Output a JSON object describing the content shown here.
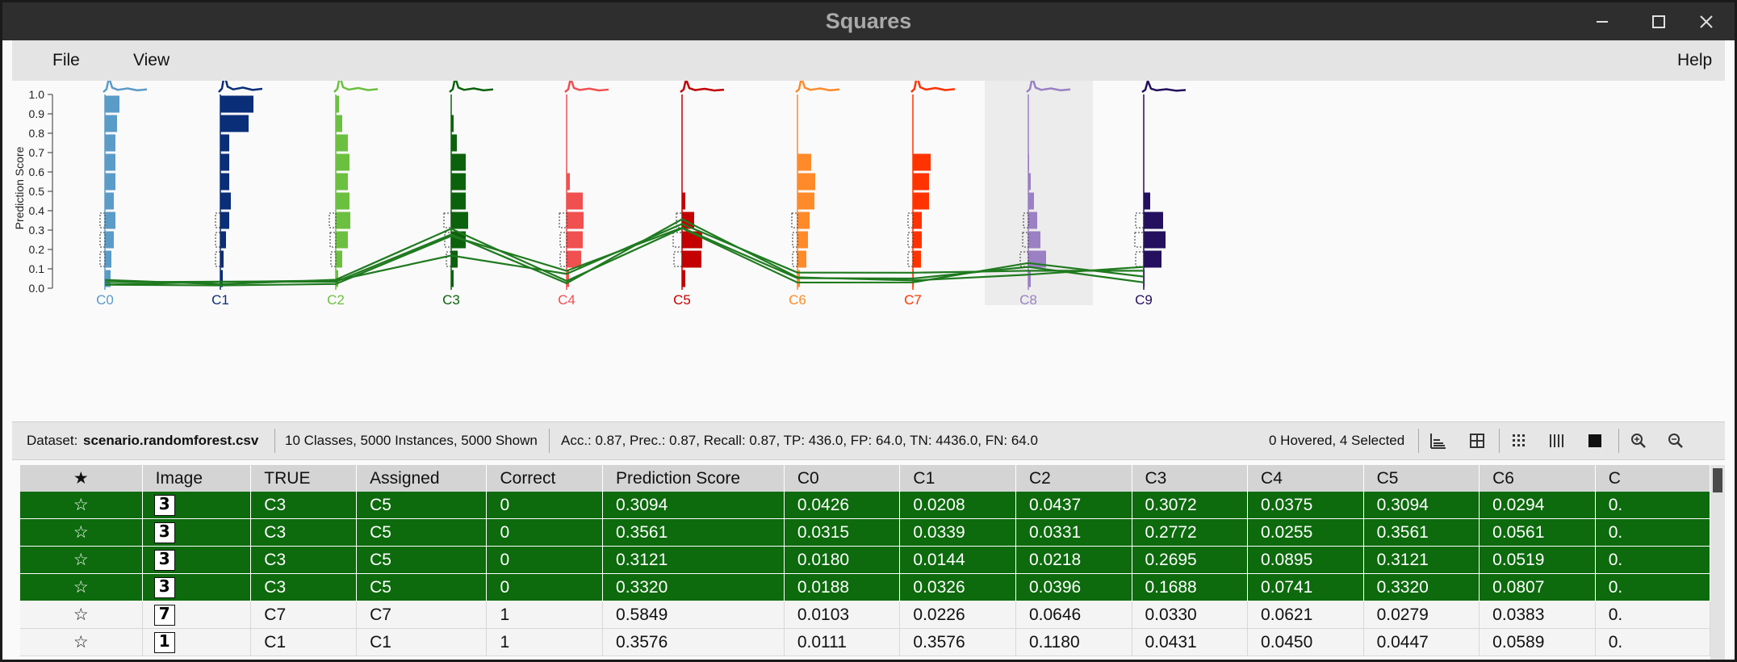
{
  "window": {
    "title": "Squares"
  },
  "menu": {
    "file": "File",
    "view": "View",
    "help": "Help"
  },
  "chart_data": {
    "type": "bar",
    "ylabel": "Prediction Score",
    "ylim": [
      0,
      1
    ],
    "yticks": [
      "0.0",
      "0.1",
      "0.2",
      "0.3",
      "0.4",
      "0.5",
      "0.6",
      "0.7",
      "0.8",
      "0.9",
      "1.0"
    ],
    "classes": [
      "C0",
      "C1",
      "C2",
      "C3",
      "C4",
      "C5",
      "C6",
      "C7",
      "C8",
      "C9"
    ],
    "colors": [
      "#5b9bc8",
      "#0a2e78",
      "#6cc040",
      "#0c620c",
      "#f05050",
      "#c40000",
      "#ff8a2a",
      "#ff3300",
      "#9b80c4",
      "#24105e"
    ],
    "hovered_class": "C8",
    "histograms": [
      [
        0.25,
        0.3,
        0.4,
        0.45,
        0.4,
        0.45,
        0.45,
        0.45,
        0.55,
        0.65
      ],
      [
        0.1,
        0.15,
        0.25,
        0.4,
        0.45,
        0.4,
        0.4,
        0.4,
        1.25,
        1.45
      ],
      [
        0.1,
        0.3,
        0.55,
        0.65,
        0.6,
        0.55,
        0.6,
        0.55,
        0.3,
        0.15
      ],
      [
        0.1,
        0.3,
        0.65,
        0.75,
        0.65,
        0.65,
        0.65,
        0.25,
        0.1,
        0.0
      ],
      [
        0.1,
        0.65,
        0.7,
        0.75,
        0.7,
        0.15,
        0.0,
        0.0,
        0.0,
        0.0
      ],
      [
        0.15,
        0.85,
        0.9,
        0.55,
        0.15,
        0.0,
        0.0,
        0.0,
        0.0,
        0.0
      ],
      [
        0.1,
        0.4,
        0.45,
        0.55,
        0.75,
        0.8,
        0.6,
        0.0,
        0.0,
        0.0
      ],
      [
        0.05,
        0.35,
        0.4,
        0.4,
        0.7,
        0.7,
        0.8,
        0.0,
        0.0,
        0.0
      ],
      [
        0.1,
        0.8,
        0.55,
        0.4,
        0.25,
        0.12,
        0.05,
        0.0,
        0.0,
        0.0
      ],
      [
        0.05,
        0.8,
        0.95,
        0.85,
        0.3,
        0.0,
        0.0,
        0.0,
        0.0,
        0.0
      ]
    ],
    "selected_lines": [
      [
        0.0426,
        0.0208,
        0.0437,
        0.3072,
        0.0375,
        0.3094,
        0.0294,
        0.03,
        0.13,
        0.06
      ],
      [
        0.0315,
        0.0339,
        0.0331,
        0.2772,
        0.0255,
        0.3561,
        0.0561,
        0.04,
        0.07,
        0.11
      ],
      [
        0.018,
        0.0144,
        0.0218,
        0.2695,
        0.0895,
        0.3121,
        0.0519,
        0.05,
        0.11,
        0.03
      ],
      [
        0.0188,
        0.0326,
        0.0396,
        0.1688,
        0.0741,
        0.332,
        0.0807,
        0.08,
        0.09,
        0.09
      ]
    ]
  },
  "status": {
    "dataset_label": "Dataset:",
    "dataset_file": "scenario.randomforest.csv",
    "counts": "10 Classes, 5000 Instances, 5000 Shown",
    "metrics": "Acc.: 0.87, Prec.: 0.87, Recall: 0.87, TP: 436.0, FP: 64.0, TN: 4436.0, FN: 64.0",
    "hover_selection": "0 Hovered, 4 Selected"
  },
  "table": {
    "star_header": "★",
    "headers": [
      "Image",
      "TRUE",
      "Assigned",
      "Correct",
      "Prediction Score",
      "C0",
      "C1",
      "C2",
      "C3",
      "C4",
      "C5",
      "C6",
      "C"
    ],
    "rows": [
      {
        "star": "☆",
        "glyph": "3",
        "selected": true,
        "cells": [
          "C3",
          "C5",
          "0",
          "0.3094",
          "0.0426",
          "0.0208",
          "0.0437",
          "0.3072",
          "0.0375",
          "0.3094",
          "0.0294",
          "0."
        ]
      },
      {
        "star": "☆",
        "glyph": "3",
        "selected": true,
        "cells": [
          "C3",
          "C5",
          "0",
          "0.3561",
          "0.0315",
          "0.0339",
          "0.0331",
          "0.2772",
          "0.0255",
          "0.3561",
          "0.0561",
          "0."
        ]
      },
      {
        "star": "☆",
        "glyph": "3",
        "selected": true,
        "cells": [
          "C3",
          "C5",
          "0",
          "0.3121",
          "0.0180",
          "0.0144",
          "0.0218",
          "0.2695",
          "0.0895",
          "0.3121",
          "0.0519",
          "0."
        ]
      },
      {
        "star": "☆",
        "glyph": "3",
        "selected": true,
        "cells": [
          "C3",
          "C5",
          "0",
          "0.3320",
          "0.0188",
          "0.0326",
          "0.0396",
          "0.1688",
          "0.0741",
          "0.3320",
          "0.0807",
          "0."
        ]
      },
      {
        "star": "☆",
        "glyph": "7",
        "selected": false,
        "cells": [
          "C7",
          "C7",
          "1",
          "0.5849",
          "0.0103",
          "0.0226",
          "0.0646",
          "0.0330",
          "0.0621",
          "0.0279",
          "0.0383",
          "0."
        ]
      },
      {
        "star": "☆",
        "glyph": "1",
        "selected": false,
        "cells": [
          "C1",
          "C1",
          "1",
          "0.3576",
          "0.0111",
          "0.3576",
          "0.1180",
          "0.0431",
          "0.0450",
          "0.0447",
          "0.0589",
          "0."
        ]
      }
    ]
  }
}
